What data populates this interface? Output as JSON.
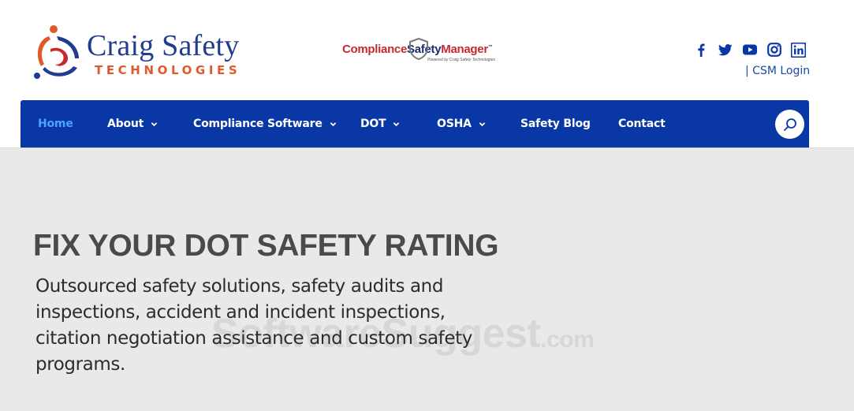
{
  "header": {
    "logo": {
      "name": "Craig Safety",
      "subtitle": "TECHNOLOGIES",
      "colors": {
        "name": "#1f3c8f",
        "subtitle": "#e0592a"
      }
    },
    "product_logo": {
      "part1": "Compliance",
      "part2": "Safety",
      "part3": "Manager",
      "tm": "™",
      "tagline": "Powered by Craig Safety Technologies"
    },
    "social_icons": [
      "facebook-icon",
      "twitter-icon",
      "youtube-icon",
      "instagram-icon",
      "linkedin-icon"
    ],
    "login_label": "| CSM Login"
  },
  "nav": {
    "items": [
      {
        "label": "Home",
        "active": true,
        "dropdown": false
      },
      {
        "label": "About",
        "active": false,
        "dropdown": true
      },
      {
        "label": "Compliance Software",
        "active": false,
        "dropdown": true
      },
      {
        "label": "DOT",
        "active": false,
        "dropdown": true
      },
      {
        "label": "OSHA",
        "active": false,
        "dropdown": true
      },
      {
        "label": "Safety Blog",
        "active": false,
        "dropdown": false
      },
      {
        "label": "Contact",
        "active": false,
        "dropdown": false
      }
    ],
    "search_icon": "search-icon",
    "colors": {
      "background": "#0937a6",
      "active": "#4ea3ff",
      "text": "#ffffff"
    }
  },
  "hero": {
    "title": "FIX YOUR DOT SAFETY RATING",
    "description": "Outsourced safety solutions, safety audits and inspections, accident and incident inspections, citation negotiation assistance and custom safety programs.",
    "background": "#e9e9e9"
  },
  "watermark": {
    "text": "SoftwareSuggest",
    "suffix": ".com"
  }
}
